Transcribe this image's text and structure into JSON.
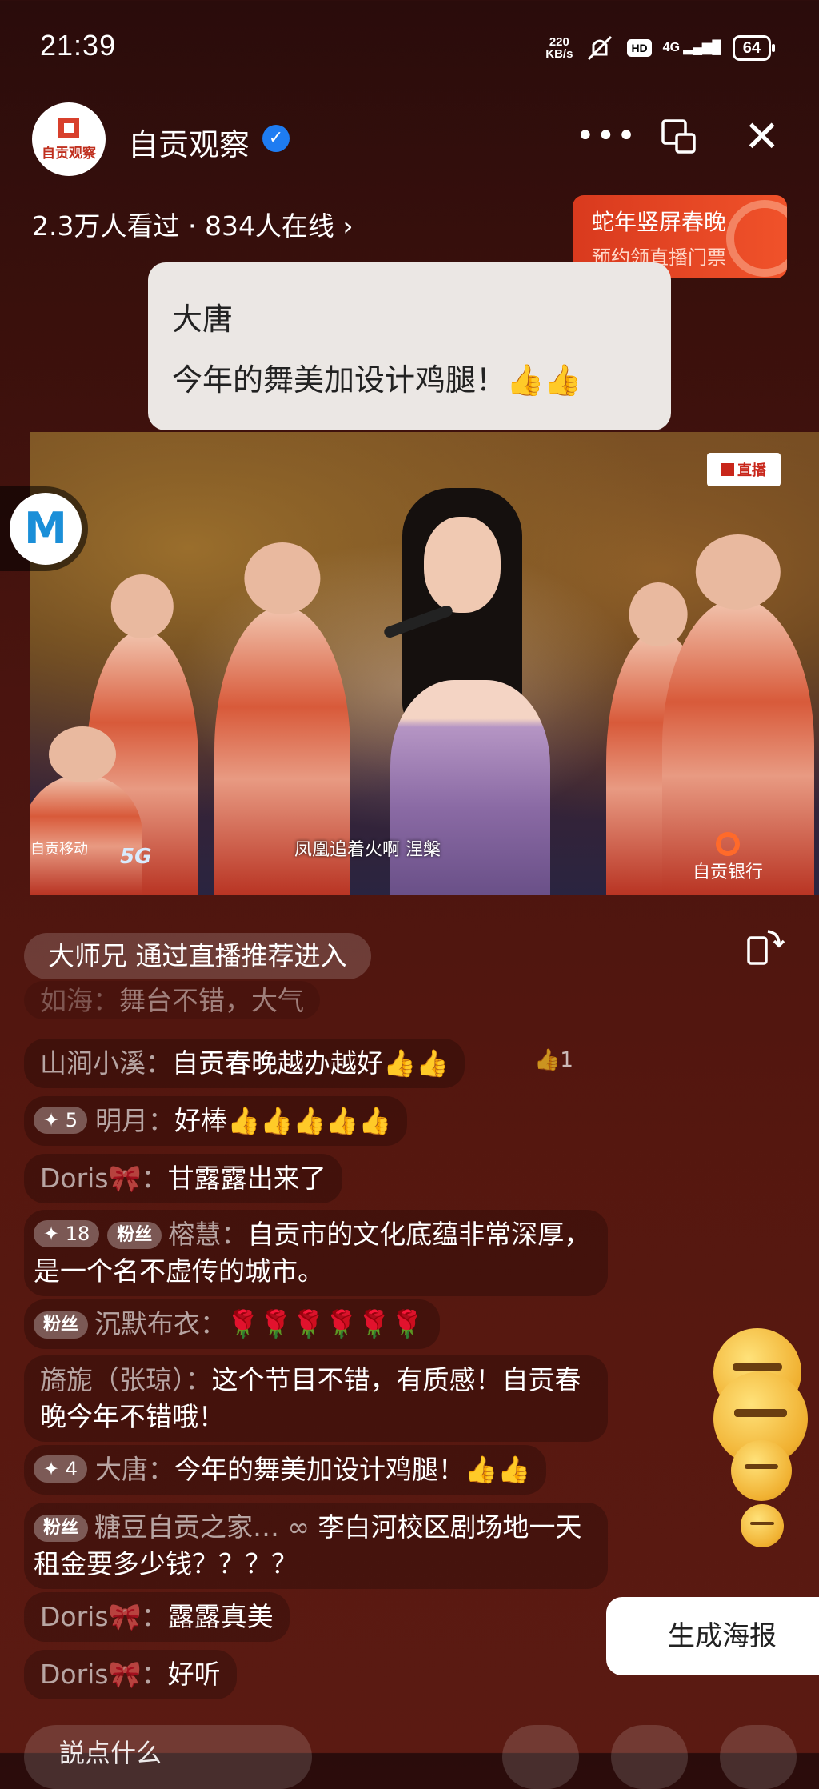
{
  "status_bar": {
    "time": "21:39",
    "speed_value": "220",
    "speed_unit": "KB/s",
    "hd": "HD",
    "network": "4G",
    "battery": "64"
  },
  "header": {
    "channel_name": "自贡观察",
    "avatar_text": "自贡观察",
    "viewers": "2.3万人看过 · 834人在线 ›"
  },
  "promo": {
    "title": "蛇年竖屏春晚",
    "subtitle": "预约领直播门票"
  },
  "popup_comment": {
    "user": "大唐",
    "text": "今年的舞美加设计鸡腿！👍👍"
  },
  "video": {
    "live_badge": "直播",
    "subtitle": "凤凰追着火啊  涅槃",
    "watermark_left": "自贡移动",
    "watermark_5g": "5G",
    "watermark_right": "自贡银行"
  },
  "side_logo": "M",
  "entry_notice": "大师兄 通过直播推荐进入",
  "comments": [
    {
      "user": "如海：",
      "text": "舞台不错，大气"
    },
    {
      "user": "山涧小溪：",
      "text": "自贡春晚越办越好👍👍",
      "likes": "1"
    },
    {
      "level": "✦ 5",
      "user": "明月：",
      "text": "好棒👍👍👍👍👍"
    },
    {
      "user": "Doris🎀：",
      "text": "甘露露出来了"
    },
    {
      "level": "✦ 18",
      "badge": "粉丝",
      "user": "榕慧：",
      "text": "自贡市的文化底蕴非常深厚，是一个名不虚传的城市。"
    },
    {
      "badge": "粉丝",
      "user": "沉默布衣：",
      "text": "🌹🌹🌹🌹🌹🌹"
    },
    {
      "user": "旖旎（张琼）：",
      "text": "这个节目不错，有质感！自贡春晚今年不错哦！"
    },
    {
      "level": "✦ 4",
      "user": "大唐：",
      "text": "今年的舞美加设计鸡腿！👍👍"
    },
    {
      "badge": "粉丝",
      "user": "糖豆自贡之家…",
      "text": "李白河校区剧场地一天租金要多少钱？？？？"
    },
    {
      "user": "Doris🎀：",
      "text": "露露真美"
    },
    {
      "user": "Doris🎀：",
      "text": "好听"
    }
  ],
  "poster_button": "生成海报",
  "input_placeholder": "説点什么"
}
